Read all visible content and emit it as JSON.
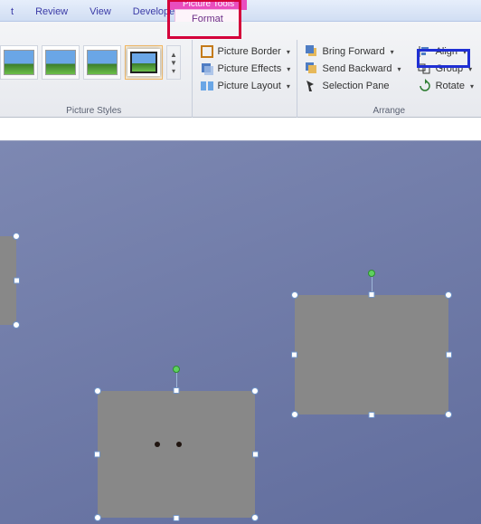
{
  "tabs": {
    "t": "t",
    "review": "Review",
    "view": "View",
    "developer": "Developer",
    "contextual_header": "Picture Tools",
    "format": "Format"
  },
  "ribbon": {
    "picture_styles": {
      "label": "Picture Styles",
      "picture_border": "Picture Border",
      "picture_effects": "Picture Effects",
      "picture_layout": "Picture Layout"
    },
    "arrange": {
      "label": "Arrange",
      "bring_forward": "Bring Forward",
      "send_backward": "Send Backward",
      "selection_pane": "Selection Pane",
      "align": "Align",
      "group": "Group",
      "rotate": "Rotate"
    }
  },
  "glyphs": {
    "dd": "▾",
    "more1": "▲",
    "more2": "▼",
    "more3": "▾"
  }
}
